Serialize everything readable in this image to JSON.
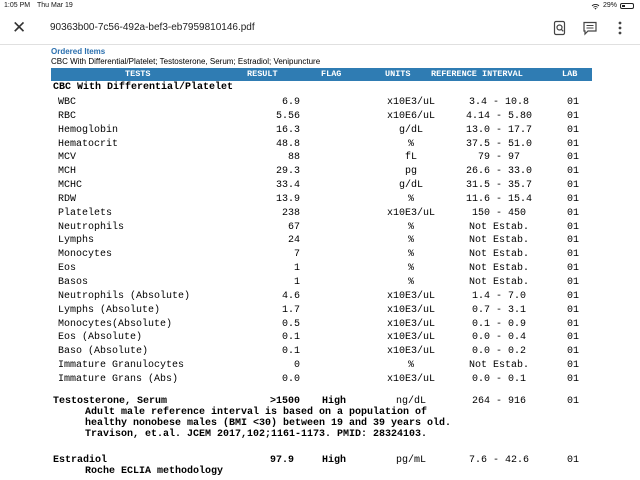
{
  "status_bar": {
    "time": "1:05 PM",
    "date": "Thu Mar 19",
    "battery": "29%",
    "battery_level": 0.29
  },
  "app_bar": {
    "close_icon": "close-icon",
    "file_name": "90363b00-7c56-492a-bef3-eb7959810146.pdf",
    "icons": [
      "search-document-icon",
      "comment-icon",
      "more-options-icon"
    ]
  },
  "ordered": {
    "title": "Ordered Items",
    "text": "CBC With Differential/Platelet; Testosterone, Serum; Estradiol; Venipuncture"
  },
  "table_header": {
    "tests": "TESTS",
    "result": "RESULT",
    "flag": "FLAG",
    "units": "UNITS",
    "reference": "REFERENCE INTERVAL",
    "lab": "LAB"
  },
  "section_title": "CBC With Differential/Platelet",
  "rows": [
    {
      "test": "WBC",
      "result": "6.9",
      "units": "x10E3/uL",
      "ref": "3.4 - 10.8",
      "lab": "01"
    },
    {
      "test": "RBC",
      "result": "5.56",
      "units": "x10E6/uL",
      "ref": "4.14 - 5.80",
      "lab": "01"
    },
    {
      "test": "Hemoglobin",
      "result": "16.3",
      "units": "g/dL",
      "ref": "13.0 - 17.7",
      "lab": "01"
    },
    {
      "test": "Hematocrit",
      "result": "48.8",
      "units": "%",
      "ref": "37.5 - 51.0",
      "lab": "01"
    },
    {
      "test": "MCV",
      "result": "88",
      "units": "fL",
      "ref": "79 - 97",
      "lab": "01"
    },
    {
      "test": "MCH",
      "result": "29.3",
      "units": "pg",
      "ref": "26.6 - 33.0",
      "lab": "01"
    },
    {
      "test": "MCHC",
      "result": "33.4",
      "units": "g/dL",
      "ref": "31.5 - 35.7",
      "lab": "01"
    },
    {
      "test": "RDW",
      "result": "13.9",
      "units": "%",
      "ref": "11.6 - 15.4",
      "lab": "01"
    },
    {
      "test": "Platelets",
      "result": "238",
      "units": "x10E3/uL",
      "ref": "150 - 450",
      "lab": "01"
    },
    {
      "test": "Neutrophils",
      "result": "67",
      "units": "%",
      "ref": "Not Estab.",
      "lab": "01"
    },
    {
      "test": "Lymphs",
      "result": "24",
      "units": "%",
      "ref": "Not Estab.",
      "lab": "01"
    },
    {
      "test": "Monocytes",
      "result": "7",
      "units": "%",
      "ref": "Not Estab.",
      "lab": "01"
    },
    {
      "test": "Eos",
      "result": "1",
      "units": "%",
      "ref": "Not Estab.",
      "lab": "01"
    },
    {
      "test": "Basos",
      "result": "1",
      "units": "%",
      "ref": "Not Estab.",
      "lab": "01"
    },
    {
      "test": "Neutrophils (Absolute)",
      "result": "4.6",
      "units": "x10E3/uL",
      "ref": "1.4 - 7.0",
      "lab": "01"
    },
    {
      "test": "Lymphs (Absolute)",
      "result": "1.7",
      "units": "x10E3/uL",
      "ref": "0.7 - 3.1",
      "lab": "01"
    },
    {
      "test": "Monocytes(Absolute)",
      "result": "0.5",
      "units": "x10E3/uL",
      "ref": "0.1 - 0.9",
      "lab": "01"
    },
    {
      "test": "Eos (Absolute)",
      "result": "0.1",
      "units": "x10E3/uL",
      "ref": "0.0 - 0.4",
      "lab": "01"
    },
    {
      "test": "Baso (Absolute)",
      "result": "0.1",
      "units": "x10E3/uL",
      "ref": "0.0 - 0.2",
      "lab": "01"
    },
    {
      "test": "Immature Granulocytes",
      "result": "0",
      "units": "%",
      "ref": "Not Estab.",
      "lab": "01"
    },
    {
      "test": "Immature Grans (Abs)",
      "result": "0.0",
      "units": "x10E3/uL",
      "ref": "0.0 - 0.1",
      "lab": "01"
    }
  ],
  "testosterone": {
    "test": "Testosterone, Serum",
    "result": ">1500",
    "flag": "High",
    "units": "ng/dL",
    "ref": "264 - 916",
    "lab": "01",
    "notes": [
      "Adult male reference interval is based on a population of",
      "healthy nonobese males (BMI <30) between 19 and 39 years old.",
      "Travison, et.al. JCEM 2017,102;1161-1173. PMID: 28324103."
    ]
  },
  "estradiol": {
    "test": "Estradiol",
    "result": "97.9",
    "flag": "High",
    "units": "pg/mL",
    "ref": "7.6 - 42.6",
    "lab": "01",
    "notes": [
      "Roche ECLIA methodology"
    ]
  },
  "colors": {
    "header_bg": "#2f7cb3",
    "ordered_title": "#2a6fae"
  }
}
